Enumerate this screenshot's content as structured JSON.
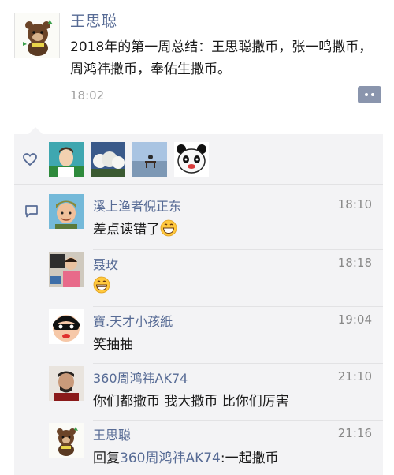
{
  "post": {
    "author": "王思聪",
    "text": "2018年的第一周总结：王思聪撒币，张一鸣撒币，周鸿祎撒币，奉佑生撒币。",
    "time": "18:02",
    "avatar_icon": "cartoon-bear-icon"
  },
  "likes": {
    "icon": "heart-outline-icon",
    "avatars": [
      "portrait-avatar",
      "tree-photo-avatar",
      "landscape-bench-avatar",
      "panda-avatar"
    ]
  },
  "comments": {
    "icon": "comment-bubble-icon",
    "items": [
      {
        "name": "溪上渔者倪正东",
        "time": "18:10",
        "text": "差点读错了",
        "emoji": "grin-emoji",
        "avatar": "cartoon-man-avatar"
      },
      {
        "name": "聂玫",
        "time": "18:18",
        "text": "",
        "emoji": "grin-emoji",
        "avatar": "child-photo-avatar"
      },
      {
        "name": "寶.天才小孩紙",
        "time": "19:04",
        "text": "笑抽抽",
        "emoji": "",
        "avatar": "masked-cartoon-avatar"
      },
      {
        "name": "360周鸿祎AK74",
        "time": "21:10",
        "text": "你们都撒币  我大撒币 比你们厉害",
        "emoji": "",
        "avatar": "man-photo-avatar"
      },
      {
        "name": "王思聪",
        "time": "21:16",
        "reply_prefix": "回复",
        "reply_target": "360周鸿祎AK74",
        "reply_text": ":一起撒币",
        "avatar": "cartoon-bear-avatar"
      }
    ]
  },
  "colors": {
    "name_link": "#576b95",
    "panel_bg": "#f3f3f5",
    "time_gray": "#a0a0a0"
  }
}
